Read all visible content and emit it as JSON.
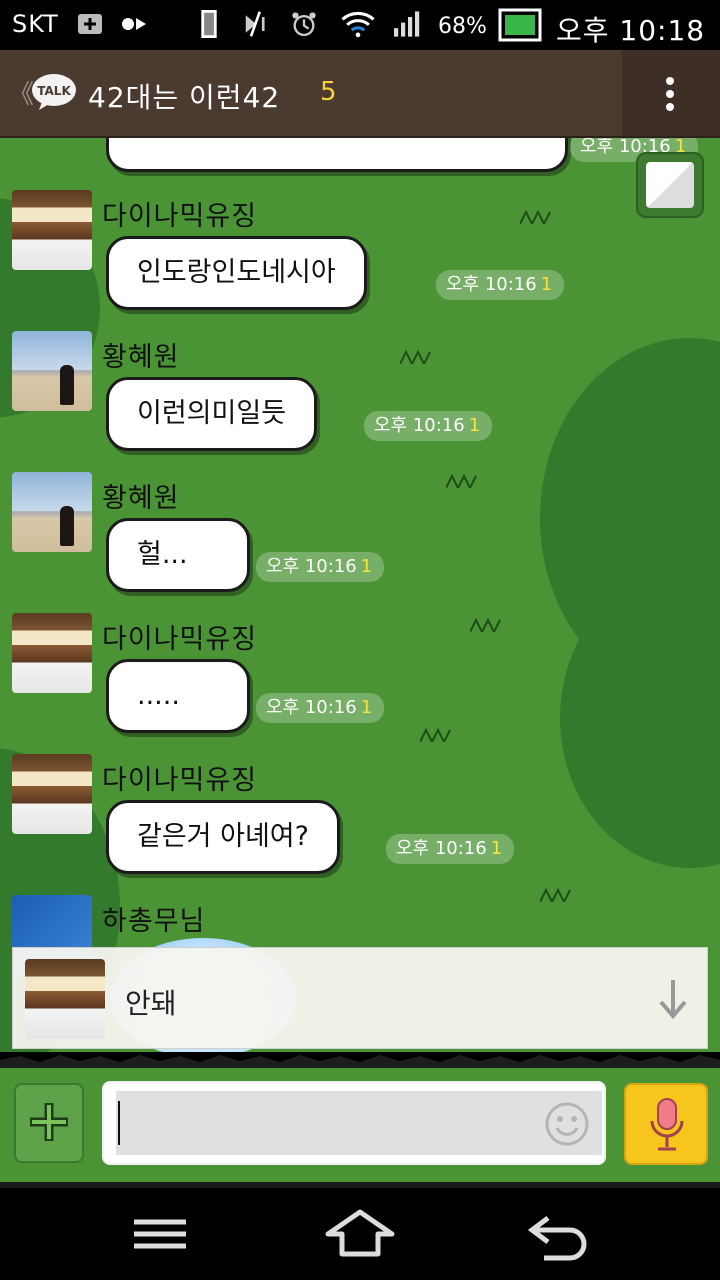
{
  "status_bar": {
    "carrier": "SKT",
    "battery": "68%",
    "time": "오후 10:18"
  },
  "header": {
    "back": "《",
    "logo_text": "TALK",
    "title": "42대는 이런42",
    "member_count": "5"
  },
  "messages": [
    {
      "sender": "다이나믹유징",
      "text": "인도랑인도네시아",
      "time": "오후 10:16",
      "unread": "1",
      "avatar": "cake"
    },
    {
      "sender": "황혜원",
      "text": "이런의미일듯",
      "time": "오후 10:16",
      "unread": "1",
      "avatar": "beach"
    },
    {
      "sender": "황혜원",
      "text": "헐...",
      "time": "오후 10:16",
      "unread": "1",
      "avatar": "beach"
    },
    {
      "sender": "다이나믹유징",
      "text": ".....",
      "time": "오후 10:16",
      "unread": "1",
      "avatar": "cake"
    },
    {
      "sender": "다이나믹유징",
      "text": "같은거 아녜여?",
      "time": "오후 10:16",
      "unread": "1",
      "avatar": "cake"
    },
    {
      "sender": "하총무님",
      "avatar": "book"
    }
  ],
  "partial_top": {
    "time": "오후 10:16",
    "unread": "1"
  },
  "notice": {
    "text": "안돼"
  },
  "input": {
    "value": "",
    "placeholder": ""
  },
  "colors": {
    "chat_bg": "#4a9436",
    "header_bg": "#4b3a30",
    "unread": "#f8e33a",
    "mic": "#f6c61c"
  }
}
